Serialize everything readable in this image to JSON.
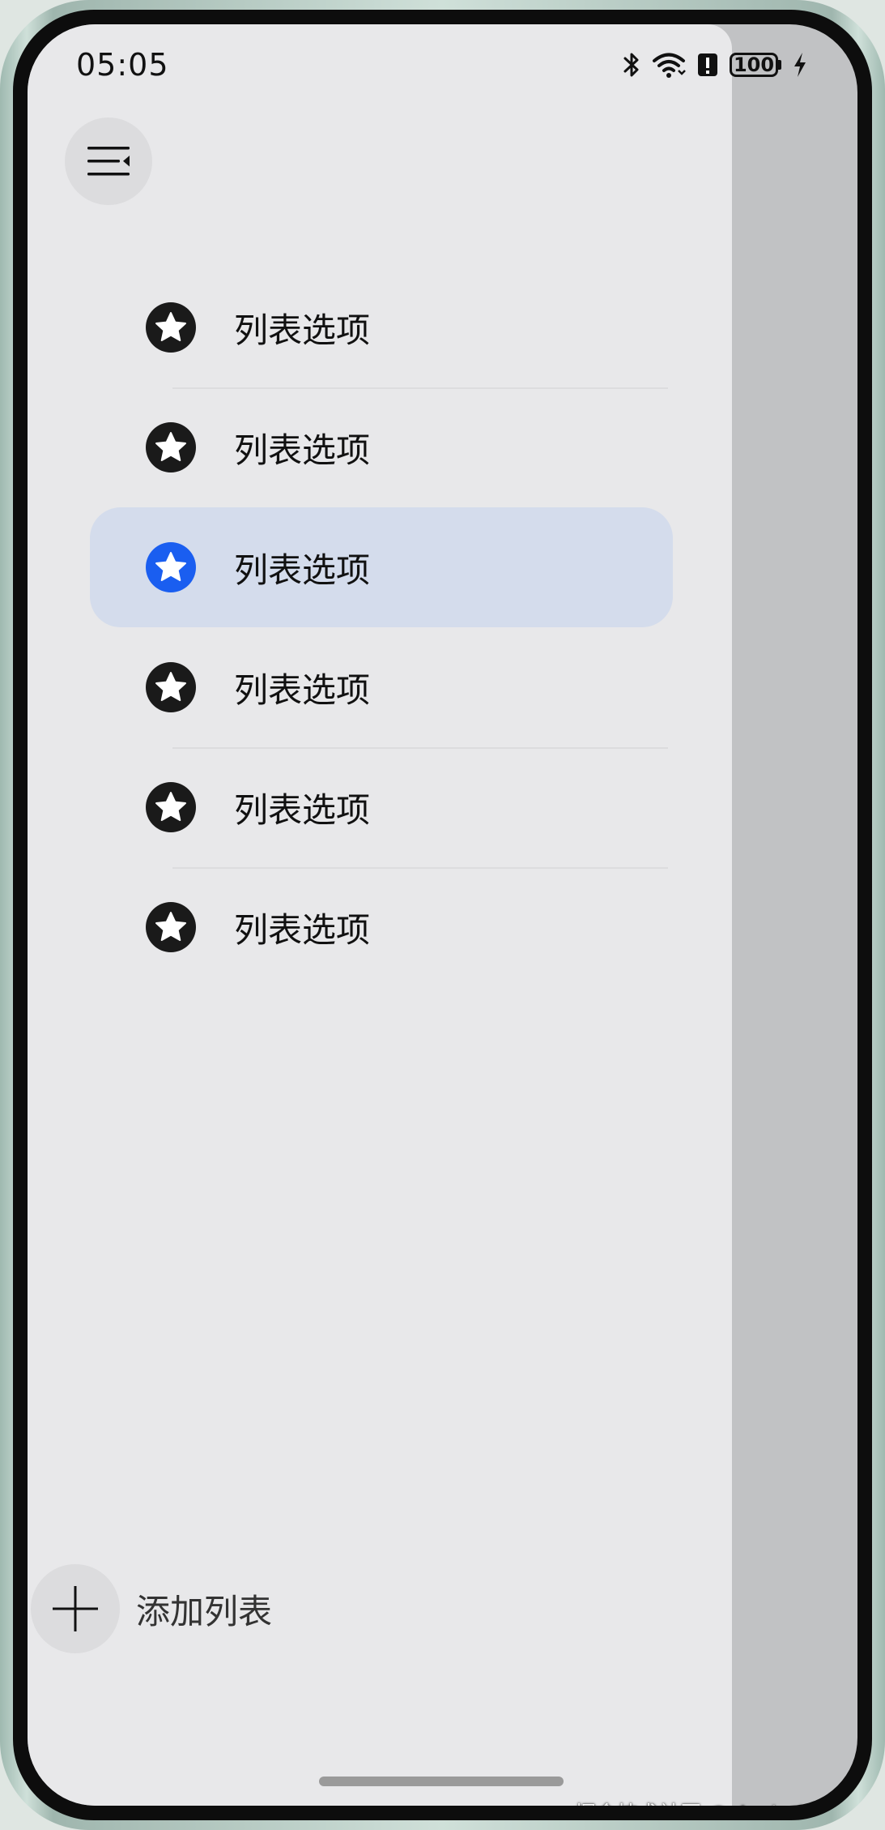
{
  "status_bar": {
    "time": "05:05",
    "battery_level": "100",
    "icons": [
      "bluetooth-icon",
      "wifi-icon",
      "alert-icon",
      "battery-icon",
      "charging-bolt-icon"
    ]
  },
  "drawer": {
    "menu_icon": "menu-collapse-icon",
    "items": [
      {
        "label": "列表选项",
        "icon": "star-icon",
        "selected": false
      },
      {
        "label": "列表选项",
        "icon": "star-icon",
        "selected": false
      },
      {
        "label": "列表选项",
        "icon": "star-icon",
        "selected": true
      },
      {
        "label": "列表选项",
        "icon": "star-icon",
        "selected": false
      },
      {
        "label": "列表选项",
        "icon": "star-icon",
        "selected": false
      },
      {
        "label": "列表选项",
        "icon": "star-icon",
        "selected": false
      }
    ],
    "add_list_label": "添加列表",
    "add_icon": "plus-icon"
  },
  "watermark": "掘金技术社区 @ Android疑难杂症",
  "colors": {
    "drawer_bg": "#e8e8ea",
    "scrim": "#c1c2c4",
    "selected_bg": "#d4dcec",
    "accent": "#1a5ef0",
    "icon_default": "#1a1a1a"
  }
}
